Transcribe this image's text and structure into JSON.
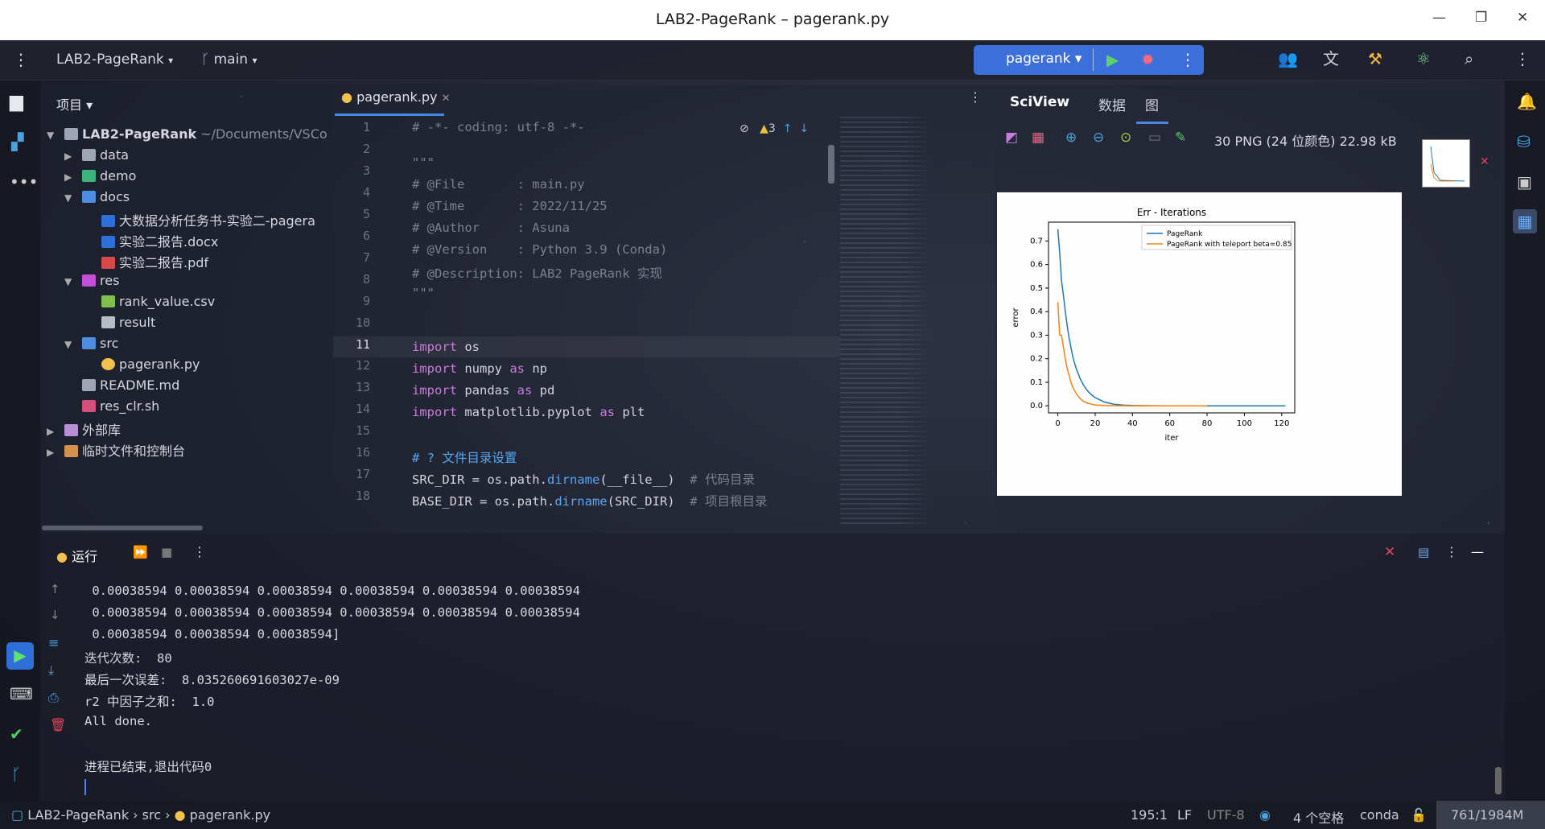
{
  "window": {
    "title": "LAB2-PageRank – pagerank.py"
  },
  "toolbar": {
    "project": "LAB2-PageRank",
    "branch": "main",
    "run_config": "pagerank"
  },
  "project_panel": {
    "title": "项目",
    "root": {
      "name": "LAB2-PageRank",
      "path": "~/Documents/VSCo"
    },
    "items": [
      {
        "label": "data",
        "kind": "folder"
      },
      {
        "label": "demo",
        "kind": "folder"
      },
      {
        "label": "docs",
        "kind": "folder"
      },
      {
        "label": "大数据分析任务书-实验二-pagera",
        "kind": "word"
      },
      {
        "label": "实验二报告.docx",
        "kind": "word"
      },
      {
        "label": "实验二报告.pdf",
        "kind": "pdf"
      },
      {
        "label": "res",
        "kind": "folder"
      },
      {
        "label": "rank_value.csv",
        "kind": "csv"
      },
      {
        "label": "result",
        "kind": "file"
      },
      {
        "label": "src",
        "kind": "folder"
      },
      {
        "label": "pagerank.py",
        "kind": "python"
      },
      {
        "label": "README.md",
        "kind": "md"
      },
      {
        "label": "res_clr.sh",
        "kind": "sh"
      },
      {
        "label": "外部库",
        "kind": "lib"
      },
      {
        "label": "临时文件和控制台",
        "kind": "scratch"
      }
    ]
  },
  "editor": {
    "tab": "pagerank.py",
    "warnings": "3",
    "line_numbers": [
      "1",
      "2",
      "3",
      "4",
      "5",
      "6",
      "7",
      "8",
      "9",
      "10",
      "11",
      "12",
      "13",
      "14",
      "15",
      "16",
      "17",
      "18"
    ]
  },
  "sciview": {
    "title": "SciView",
    "tab_data": "数据",
    "tab_plot": "图",
    "image_info": "30 PNG (24 位颜色) 22.98 kB"
  },
  "chart_data": {
    "type": "line",
    "title": "Err - Iterations",
    "xlabel": "iter",
    "ylabel": "error",
    "xlim": [
      -5,
      127
    ],
    "ylim": [
      -0.03,
      0.78
    ],
    "xticks": [
      "0",
      "20",
      "40",
      "60",
      "80",
      "100",
      "120"
    ],
    "yticks": [
      "0.0",
      "0.1",
      "0.2",
      "0.3",
      "0.4",
      "0.5",
      "0.6",
      "0.7"
    ],
    "legend_position": "top-right",
    "grid": false,
    "series": [
      {
        "name": "PageRank",
        "color": "#1f77b4",
        "x": [
          0,
          1,
          2,
          3,
          4,
          5,
          6,
          7,
          8,
          9,
          10,
          12,
          14,
          16,
          18,
          20,
          25,
          30,
          35,
          40,
          50,
          60,
          80,
          100,
          122
        ],
        "y": [
          0.75,
          0.65,
          0.53,
          0.47,
          0.4,
          0.34,
          0.29,
          0.25,
          0.21,
          0.18,
          0.155,
          0.115,
          0.085,
          0.063,
          0.047,
          0.035,
          0.016,
          0.007,
          0.003,
          0.0015,
          0.0003,
          0.0001,
          0.0,
          0.0,
          0.0
        ]
      },
      {
        "name": "PageRank with teleport beta=0.85",
        "color": "#ff7f0e",
        "x": [
          0,
          1,
          2,
          3,
          4,
          5,
          6,
          7,
          8,
          10,
          12,
          14,
          16,
          18,
          20,
          25,
          30,
          40,
          60,
          80
        ],
        "y": [
          0.44,
          0.3,
          0.3,
          0.25,
          0.2,
          0.16,
          0.13,
          0.1,
          0.08,
          0.05,
          0.03,
          0.018,
          0.011,
          0.007,
          0.004,
          0.001,
          0.0003,
          0.0,
          0.0,
          0.0
        ]
      }
    ]
  },
  "run_panel": {
    "title": "运行",
    "output": [
      " 0.00038594 0.00038594 0.00038594 0.00038594 0.00038594 0.00038594",
      " 0.00038594 0.00038594 0.00038594 0.00038594 0.00038594 0.00038594",
      " 0.00038594 0.00038594 0.00038594]",
      "迭代次数:  80",
      "最后一次误差:  8.035260691603027e-09",
      "r2 中因子之和:  1.0",
      "All done.",
      "",
      "进程已结束,退出代码0"
    ]
  },
  "status": {
    "crumb_project": "LAB2-PageRank",
    "crumb_folder": "src",
    "crumb_file": "pagerank.py",
    "position": "195:1",
    "line_sep": "LF",
    "encoding": "UTF-8",
    "indent": "4 个空格",
    "interpreter": "conda",
    "memory": "761/1984M"
  }
}
